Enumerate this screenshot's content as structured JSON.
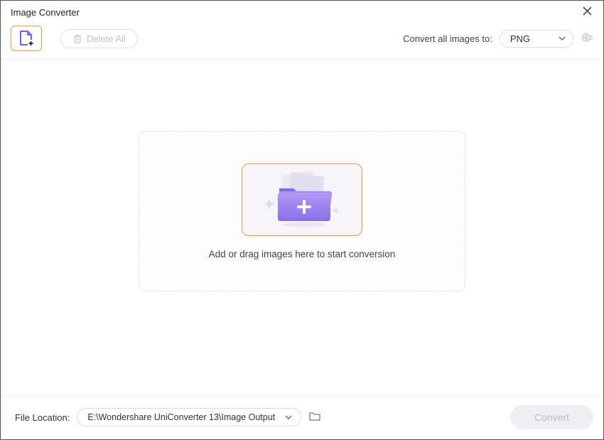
{
  "window": {
    "title": "Image Converter"
  },
  "toolbar": {
    "delete_all_label": "Delete All",
    "convert_all_label": "Convert all images to:",
    "selected_format": "PNG"
  },
  "dropzone": {
    "instruction": "Add or drag images here to start conversion"
  },
  "footer": {
    "file_location_label": "File Location:",
    "file_location_path": "E:\\Wondershare UniConverter 13\\Image Output",
    "convert_label": "Convert"
  },
  "colors": {
    "accent_orange": "#ec9d40",
    "folder_purple_light": "#a48cf0",
    "folder_purple_dark": "#8668e8"
  }
}
